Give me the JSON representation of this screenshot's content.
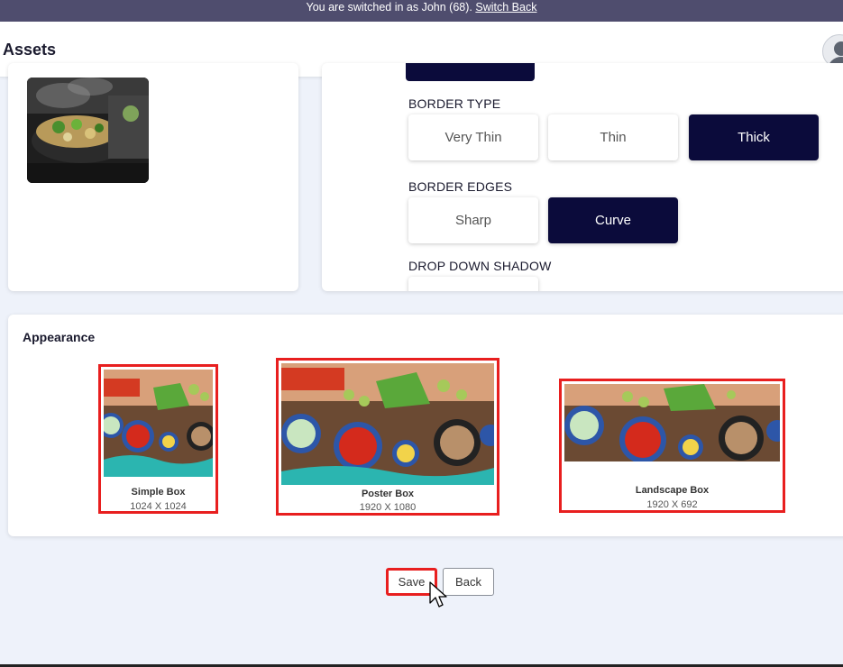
{
  "banner": {
    "text": "You are switched in as John (68).",
    "link": "Switch Back"
  },
  "header": {
    "title": "Assets",
    "avatar_icon": "user-avatar-icon"
  },
  "settings": {
    "border_type": {
      "label": "BORDER TYPE",
      "options": [
        "Very Thin",
        "Thin",
        "Thick"
      ],
      "selected": "Thick"
    },
    "border_edges": {
      "label": "BORDER EDGES",
      "options": [
        "Sharp",
        "Curve"
      ],
      "selected": "Curve"
    },
    "drop_down_shadow": {
      "label": "DROP DOWN SHADOW"
    }
  },
  "appearance": {
    "title": "Appearance",
    "boxes": [
      {
        "name": "Simple Box",
        "dims": "1024 X 1024"
      },
      {
        "name": "Poster Box",
        "dims": "1920 X 1080"
      },
      {
        "name": "Landscape Box",
        "dims": "1920 X 692"
      }
    ]
  },
  "actions": {
    "save": "Save",
    "back": "Back"
  },
  "colors": {
    "accent_dark": "#0b0b3b",
    "highlight_red": "#e81f1f",
    "banner_bg": "#4f4d6e"
  }
}
